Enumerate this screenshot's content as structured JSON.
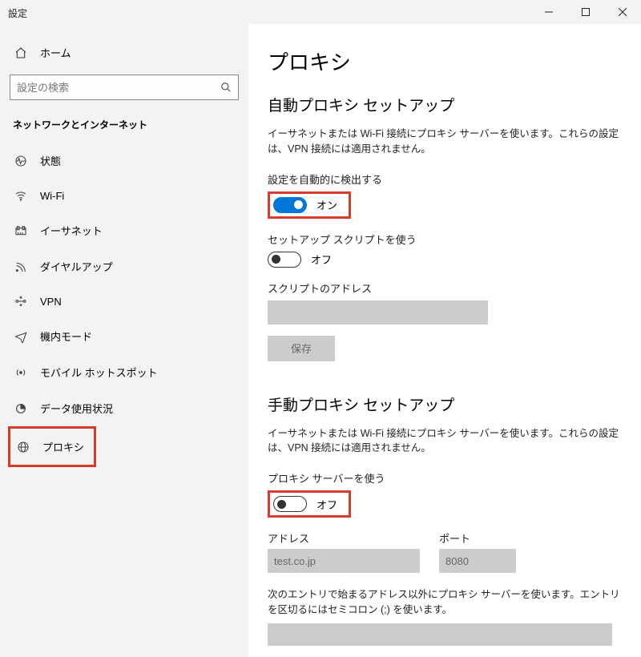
{
  "titlebar": {
    "caption": "設定"
  },
  "sidebar": {
    "home_label": "ホーム",
    "search_placeholder": "設定の検索",
    "category_title": "ネットワークとインターネット",
    "items": [
      {
        "label": "状態"
      },
      {
        "label": "Wi-Fi"
      },
      {
        "label": "イーサネット"
      },
      {
        "label": "ダイヤルアップ"
      },
      {
        "label": "VPN"
      },
      {
        "label": "機内モード"
      },
      {
        "label": "モバイル ホットスポット"
      },
      {
        "label": "データ使用状況"
      },
      {
        "label": "プロキシ"
      }
    ]
  },
  "page": {
    "title": "プロキシ",
    "auto": {
      "title": "自動プロキシ セットアップ",
      "desc": "イーサネットまたは Wi-Fi 接続にプロキシ サーバーを使います。これらの設定は、VPN 接続には適用されません。",
      "detect_label": "設定を自動的に検出する",
      "detect_state": "オン",
      "script_label": "セットアップ スクリプトを使う",
      "script_state": "オフ",
      "script_addr_label": "スクリプトのアドレス",
      "script_addr_value": "",
      "save_label": "保存"
    },
    "manual": {
      "title": "手動プロキシ セットアップ",
      "desc": "イーサネットまたは Wi-Fi 接続にプロキシ サーバーを使います。これらの設定は、VPN 接続には適用されません。",
      "use_label": "プロキシ サーバーを使う",
      "use_state": "オフ",
      "addr_label": "アドレス",
      "addr_value": "test.co.jp",
      "port_label": "ポート",
      "port_value": "8080",
      "exclusion_label": "次のエントリで始まるアドレス以外にプロキシ サーバーを使います。エントリを区切るにはセミコロン (;) を使います。"
    }
  },
  "highlights": {
    "proxy_nav": true,
    "auto_detect_toggle": true,
    "manual_use_toggle": true
  }
}
